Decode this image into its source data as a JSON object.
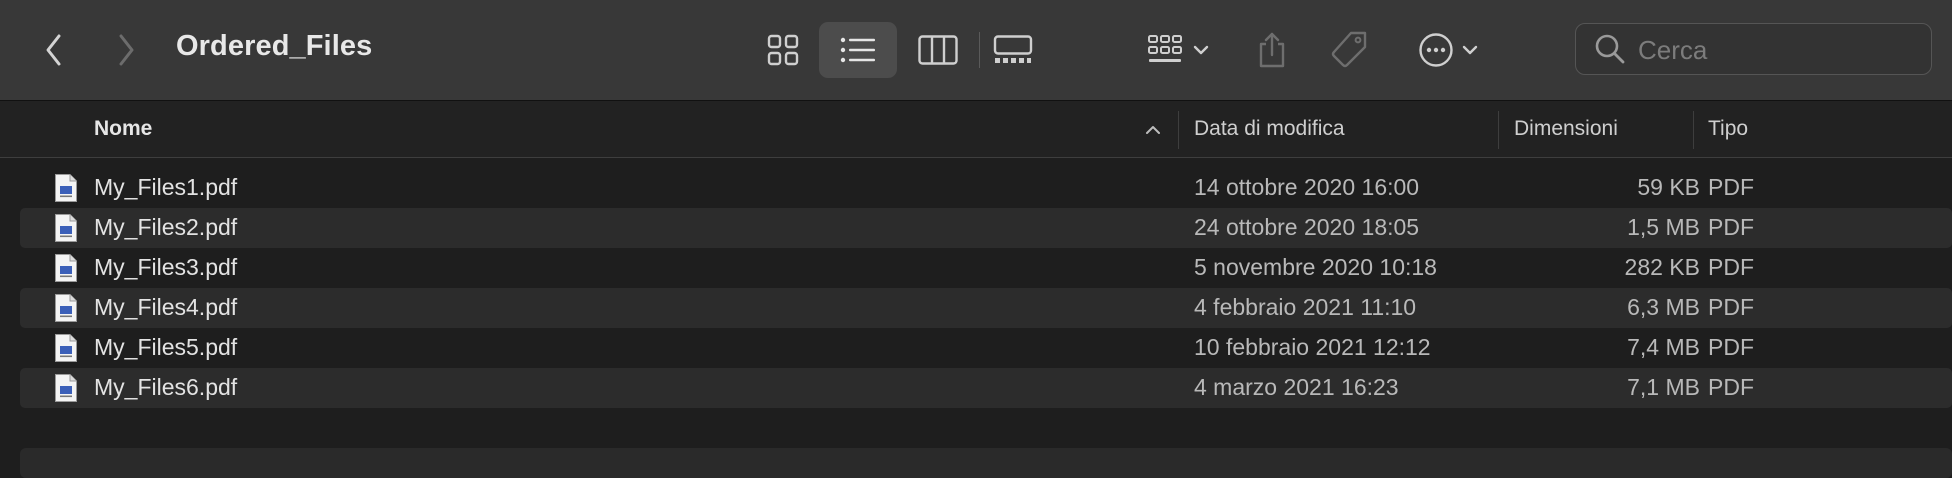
{
  "window": {
    "title": "Ordered_Files"
  },
  "search": {
    "placeholder": "Cerca",
    "value": ""
  },
  "columns": {
    "name": "Nome",
    "date": "Data di modifica",
    "size": "Dimensioni",
    "kind": "Tipo"
  },
  "files": [
    {
      "name": "My_Files1.pdf",
      "date": "14 ottobre 2020 16:00",
      "size": "59 KB",
      "kind": "PDF"
    },
    {
      "name": "My_Files2.pdf",
      "date": "24 ottobre 2020 18:05",
      "size": "1,5 MB",
      "kind": "PDF"
    },
    {
      "name": "My_Files3.pdf",
      "date": "5 novembre 2020 10:18",
      "size": "282 KB",
      "kind": "PDF"
    },
    {
      "name": "My_Files4.pdf",
      "date": "4 febbraio 2021 11:10",
      "size": "6,3 MB",
      "kind": "PDF"
    },
    {
      "name": "My_Files5.pdf",
      "date": "10 febbraio 2021 12:12",
      "size": "7,4 MB",
      "kind": "PDF"
    },
    {
      "name": "My_Files6.pdf",
      "date": "4 marzo 2021 16:23",
      "size": "7,1 MB",
      "kind": "PDF"
    }
  ],
  "toolbar": {
    "icons": [
      "back-icon",
      "forward-icon",
      "icon-view-icon",
      "list-view-icon",
      "column-view-icon",
      "gallery-view-icon",
      "group-icon",
      "share-icon",
      "tag-icon",
      "more-actions-icon",
      "search-icon"
    ],
    "selected_view": "list"
  },
  "colors": {
    "toolbar_bg": "#383838",
    "window_bg": "#1e1e1e",
    "row_alt_bg": "#2c2c2c",
    "selected_view_bg": "#4c4c4c"
  }
}
